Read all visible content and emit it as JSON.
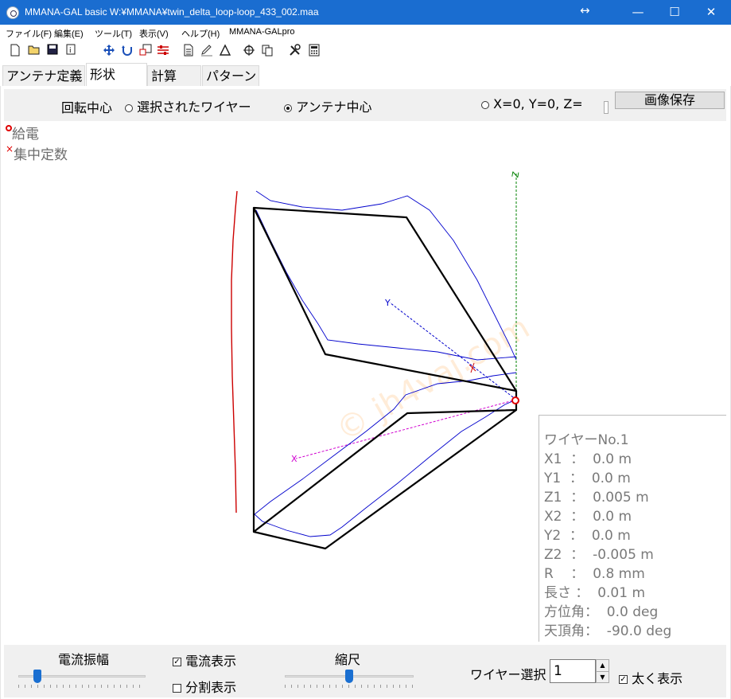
{
  "window": {
    "title": "MMANA-GAL basic  W:¥MMANA¥twin_delta_loop-loop_433_002.maa",
    "drag_glyph": "↔",
    "minimize": "—",
    "maximize": "☐",
    "close": "✕"
  },
  "menu": [
    "ファイル(F)",
    "編集(E)",
    "ツール(T)",
    "表示(V)",
    "ヘルプ(H)",
    "MMANA-GALpro"
  ],
  "toolbar": {
    "icons": [
      "new-file-icon",
      "open-folder-icon",
      "save-disk-icon",
      "info-icon",
      "move-arrows-icon",
      "rotate-icon",
      "zoom-icon",
      "sliders-icon",
      "document-icon",
      "pen-icon",
      "triangle-icon",
      "crosshair-icon",
      "copy-icon",
      "tools-icon",
      "calculator-icon"
    ]
  },
  "tabs": [
    {
      "label": "アンテナ定義",
      "active": false
    },
    {
      "label": "形状",
      "active": true
    },
    {
      "label": "計算",
      "active": false
    },
    {
      "label": "パターン",
      "active": false
    }
  ],
  "rotation": {
    "label": "回転中心",
    "option_selected_wire": "選択されたワイヤー",
    "option_antenna_center": "アンテナ中心",
    "option_xyz": "X=0, Y=0, Z=",
    "selected": "antenna_center",
    "save_button": "画像保存"
  },
  "legend": {
    "feed_label": "給電",
    "load_label": "集中定数",
    "feed_color": "#e00000",
    "load_color": "#e00000"
  },
  "canvas": {
    "watermark": "© jh4vaj.com",
    "axis_z_label": "Z",
    "axis_y_label": "Y",
    "axis_x_label": "X"
  },
  "info": {
    "title": "ワイヤーNo.1",
    "lines": [
      "X1  ：  0.0 m",
      "Y1  ：  0.0 m",
      "Z1  ：  0.005 m",
      "X2  ：  0.0 m",
      "Y2  ：  0.0 m",
      "Z2  ：  -0.005 m",
      "R    ：  0.8 mm",
      "長さ ：  0.01 m",
      "方位角：  0.0 deg",
      "天頂角：  -90.0 deg"
    ]
  },
  "bottom": {
    "current_amplitude_label": "電流振幅",
    "show_current_label": "電流表示",
    "show_current_checked": true,
    "show_segments_label": "分割表示",
    "show_segments_checked": false,
    "scale_label": "縮尺",
    "wire_select_label": "ワイヤー選択",
    "wire_select_value": "1",
    "bold_label": "太く表示",
    "bold_checked": true,
    "current_amplitude_level": 0.15,
    "scale_level": 0.5
  },
  "colors": {
    "titlebar": "#1a6dd0",
    "wire": "#000000",
    "current": "#0000cc",
    "ground": "#cc0000",
    "axis_z": "#008000",
    "axis_x": "#d000d0",
    "axis_y": "#0000cc"
  }
}
